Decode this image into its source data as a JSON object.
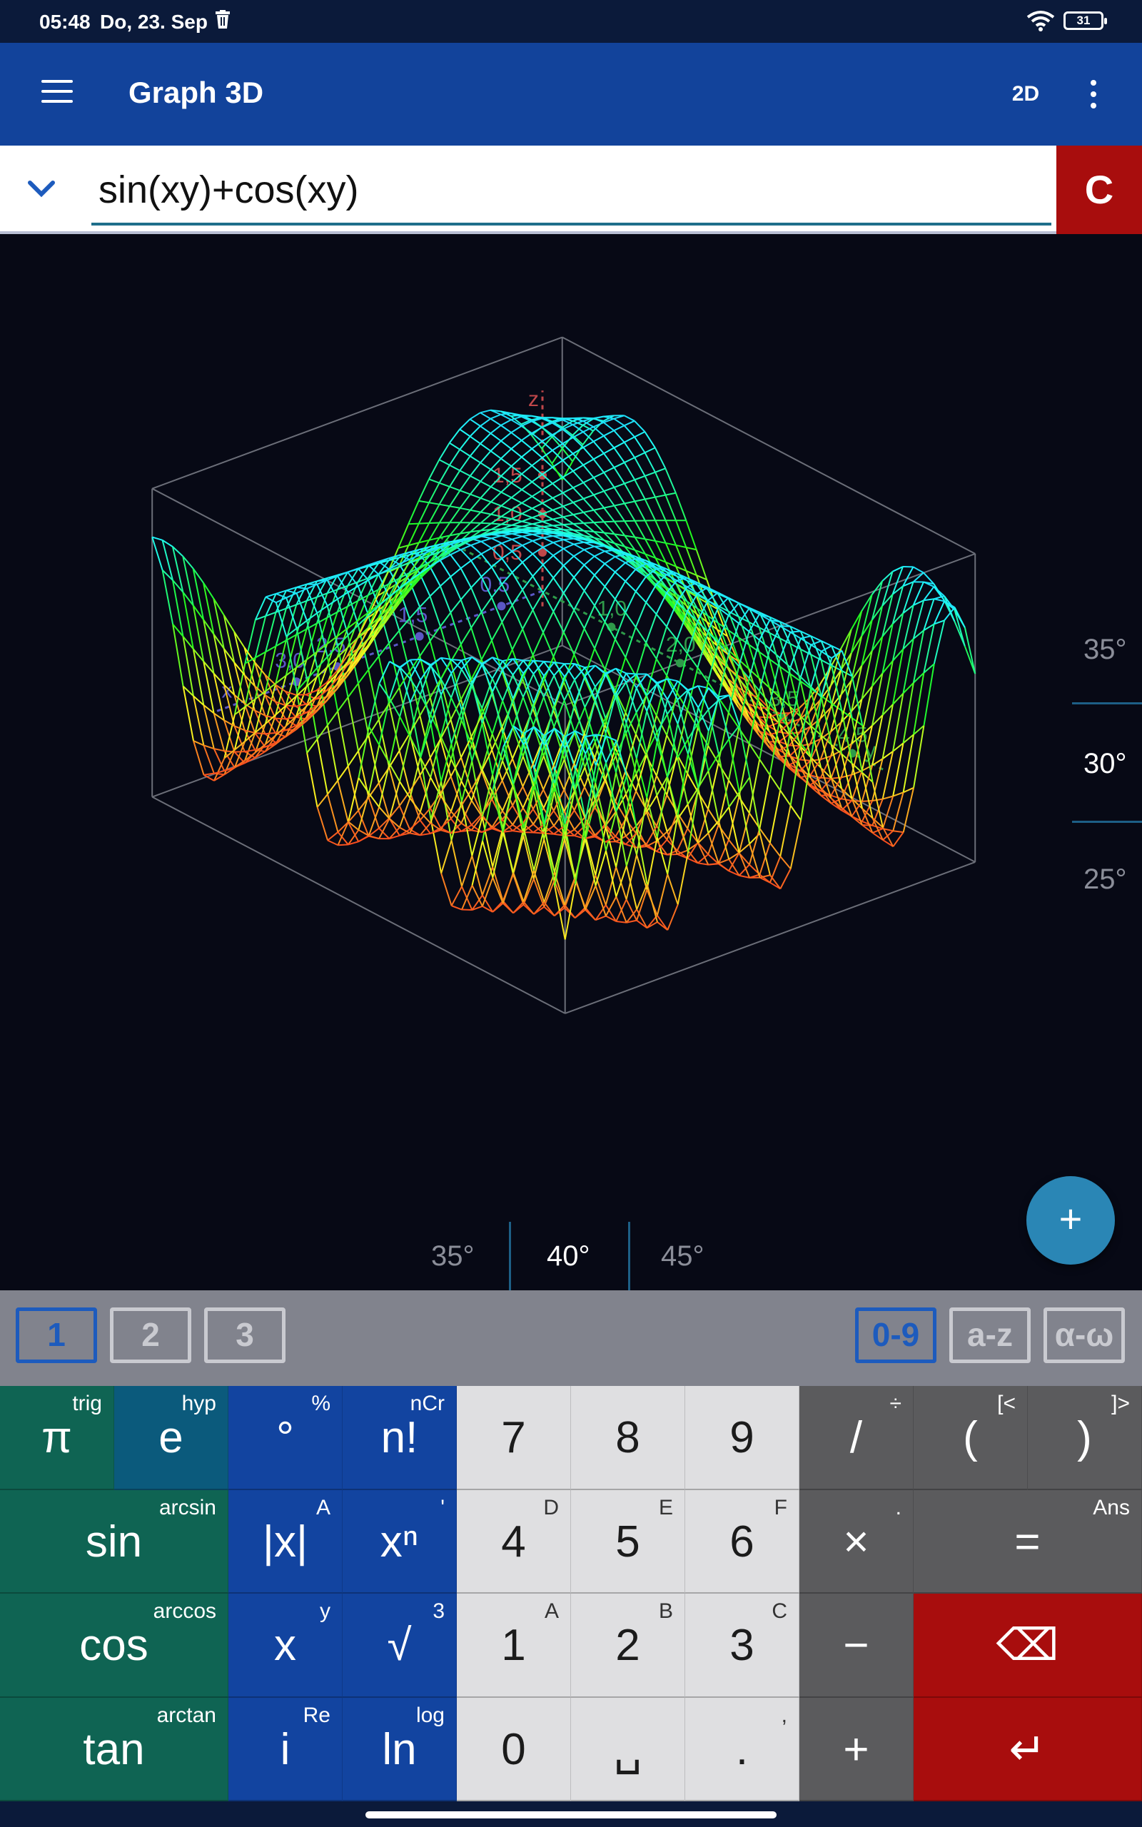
{
  "status_bar": {
    "time": "05:48",
    "date": "Do, 23. Sep",
    "battery": "31"
  },
  "app_bar": {
    "title": "Graph 3D",
    "mode_label": "2D"
  },
  "input": {
    "expression": "sin(xy)+cos(xy)",
    "clear_label": "C"
  },
  "graph": {
    "z_axis": {
      "label": "z",
      "ticks": [
        "0,5",
        "1,0",
        "1,5"
      ]
    },
    "x_axis": {
      "label": "x",
      "ticks": [
        "0,5",
        "1,5",
        "2,5",
        "3,0"
      ]
    },
    "y_axis": {
      "label": "y",
      "ticks": [
        "1,0",
        "2,0",
        "3,5",
        "4,5",
        "1,5",
        "-1,0"
      ]
    },
    "vertical_rotation": {
      "values": [
        "35°",
        "30°",
        "25°"
      ],
      "selected": "30°"
    },
    "horizontal_rotation": {
      "values": [
        "35°",
        "40°",
        "45°"
      ],
      "selected": "40°"
    },
    "fab_label": "+"
  },
  "tabs": {
    "pages": [
      "1",
      "2",
      "3"
    ],
    "active_page": "1",
    "modes": [
      "0-9",
      "a-z",
      "α-ω"
    ],
    "active_mode": "0-9"
  },
  "keypad": {
    "keys": [
      {
        "main": "π",
        "sup": "trig"
      },
      {
        "main": "e",
        "sup": "hyp"
      },
      {
        "main": "°",
        "sup": "%"
      },
      {
        "main": "n!",
        "sup": "nCr"
      },
      {
        "main": "7",
        "sup": ""
      },
      {
        "main": "8",
        "sup": ""
      },
      {
        "main": "9",
        "sup": ""
      },
      {
        "main": "/",
        "sup": "÷"
      },
      {
        "main": "(",
        "sup": "[<"
      },
      {
        "main": ")",
        "sup": "]>"
      },
      {
        "main": "sin",
        "sup": "arcsin"
      },
      {
        "main": "|x|",
        "sup": "A"
      },
      {
        "main": "xⁿ",
        "sup": "'"
      },
      {
        "main": "4",
        "sup": "D"
      },
      {
        "main": "5",
        "sup": "E"
      },
      {
        "main": "6",
        "sup": "F"
      },
      {
        "main": "×",
        "sup": "."
      },
      {
        "main": "=",
        "sup": "Ans"
      },
      {
        "main": "cos",
        "sup": "arccos"
      },
      {
        "main": "x",
        "sup": "y"
      },
      {
        "main": "√",
        "sup": "3"
      },
      {
        "main": "1",
        "sup": "A"
      },
      {
        "main": "2",
        "sup": "B"
      },
      {
        "main": "3",
        "sup": "C"
      },
      {
        "main": "−",
        "sup": ""
      },
      {
        "main": "⌫",
        "sup": ""
      },
      {
        "main": "tan",
        "sup": "arctan"
      },
      {
        "main": "i",
        "sup": "Re"
      },
      {
        "main": "ln",
        "sup": "log"
      },
      {
        "main": "0",
        "sup": ""
      },
      {
        "main": "␣",
        "sup": ""
      },
      {
        "main": ".",
        "sup": ","
      },
      {
        "main": "+",
        "sup": ""
      },
      {
        "main": "↵",
        "sup": ""
      }
    ]
  },
  "colors": {
    "app_bar": "#12439b",
    "clear_button": "#a80d0d",
    "fab": "#2a86b5",
    "key_function": "#0f6453",
    "key_accent": "#1244a0",
    "key_digit": "#dfdfe1",
    "key_operator": "#5b5b5d"
  }
}
